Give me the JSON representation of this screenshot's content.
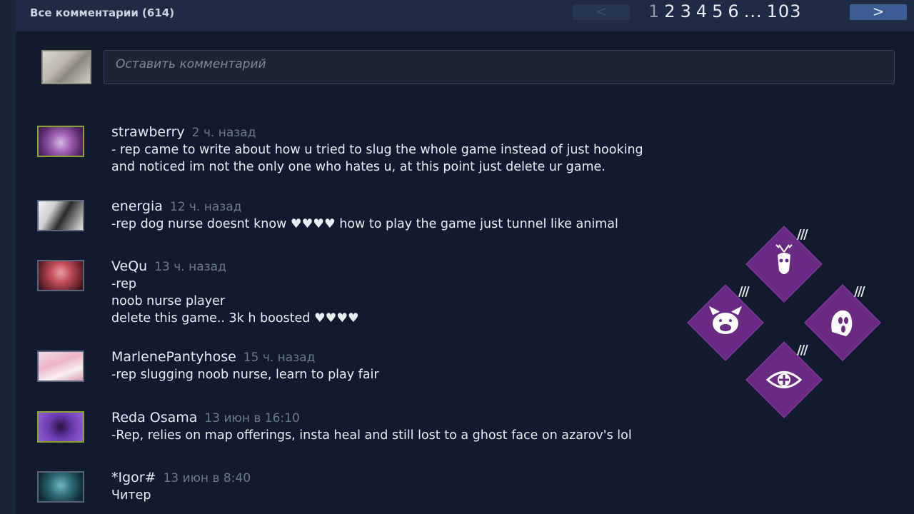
{
  "header": {
    "title": "Все комментарии (614)",
    "prev_label": "<",
    "current_page": "1",
    "pages": [
      "2",
      "3",
      "4",
      "5",
      "6"
    ],
    "ellipsis": "...",
    "last_page": "103",
    "next_label": ">"
  },
  "composer": {
    "placeholder": "Оставить комментарий"
  },
  "comments": [
    {
      "author": "strawberry",
      "time": "2 ч. назад",
      "text": "- rep came to write about how u tried to slug the whole game instead of just hooking\nand noticed im not the only one who hates u, at this point just delete ur game."
    },
    {
      "author": "energia",
      "time": "12 ч. назад",
      "text": "-rep dog nurse doesnt know ♥♥♥♥ how to play the game just tunnel like animal"
    },
    {
      "author": "VeQu",
      "time": "13 ч. назад",
      "text": "-rep\nnoob nurse player\ndelete this game.. 3k h boosted ♥♥♥♥"
    },
    {
      "author": "MarlenePantyhose",
      "time": "15 ч. назад",
      "text": "-rep slugging noob nurse, learn to play fair"
    },
    {
      "author": "Reda Osama",
      "time": "13 июн в 16:10",
      "text": "-Rep, relies on map offerings, insta heal and still lost to a ghost face on azarov's lol"
    },
    {
      "author": "*Igor#",
      "time": "13 июн в 8:40",
      "text": "Читер"
    }
  ],
  "overlay": {
    "perks": [
      "deer-skull-perk-icon",
      "pig-perk-icon",
      "ghostface-perk-icon",
      "eye-perk-icon"
    ],
    "accent": "#6a2a83"
  }
}
